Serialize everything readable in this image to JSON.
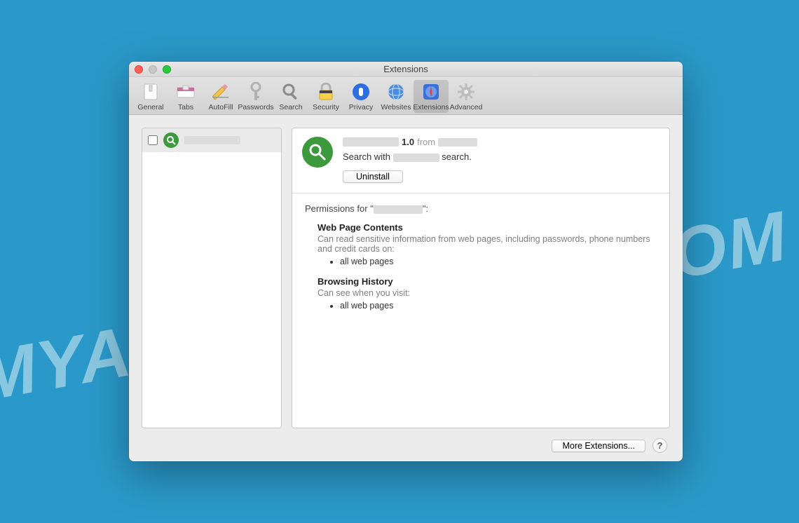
{
  "watermark": "MYANTISPYWARE.COM",
  "window": {
    "title": "Extensions"
  },
  "toolbar": [
    {
      "label": "General",
      "icon": "general-icon",
      "selected": false
    },
    {
      "label": "Tabs",
      "icon": "tabs-icon",
      "selected": false
    },
    {
      "label": "AutoFill",
      "icon": "autofill-icon",
      "selected": false
    },
    {
      "label": "Passwords",
      "icon": "passwords-icon",
      "selected": false
    },
    {
      "label": "Search",
      "icon": "search-icon",
      "selected": false
    },
    {
      "label": "Security",
      "icon": "security-icon",
      "selected": false
    },
    {
      "label": "Privacy",
      "icon": "privacy-icon",
      "selected": false
    },
    {
      "label": "Websites",
      "icon": "websites-icon",
      "selected": false
    },
    {
      "label": "Extensions",
      "icon": "extensions-icon",
      "selected": true
    },
    {
      "label": "Advanced",
      "icon": "advanced-icon",
      "selected": false
    }
  ],
  "sidebar": {
    "items": [
      {
        "name_redacted": "██████████",
        "checked": false
      }
    ]
  },
  "extension": {
    "name_redacted": "████████",
    "version": "1.0",
    "from_label": "from",
    "developer_redacted": "██████",
    "description_prefix": "Search with",
    "description_mid_redacted": "██████",
    "description_suffix": "search.",
    "uninstall_label": "Uninstall"
  },
  "permissions": {
    "title_prefix": "Permissions for \"",
    "title_name_redacted": "████████",
    "title_suffix": "\":",
    "sections": [
      {
        "heading": "Web Page Contents",
        "description": "Can read sensitive information from web pages, including passwords, phone numbers and credit cards on:",
        "items": [
          "all web pages"
        ]
      },
      {
        "heading": "Browsing History",
        "description": "Can see when you visit:",
        "items": [
          "all web pages"
        ]
      }
    ]
  },
  "footer": {
    "more_extensions_label": "More Extensions...",
    "help_label": "?"
  }
}
